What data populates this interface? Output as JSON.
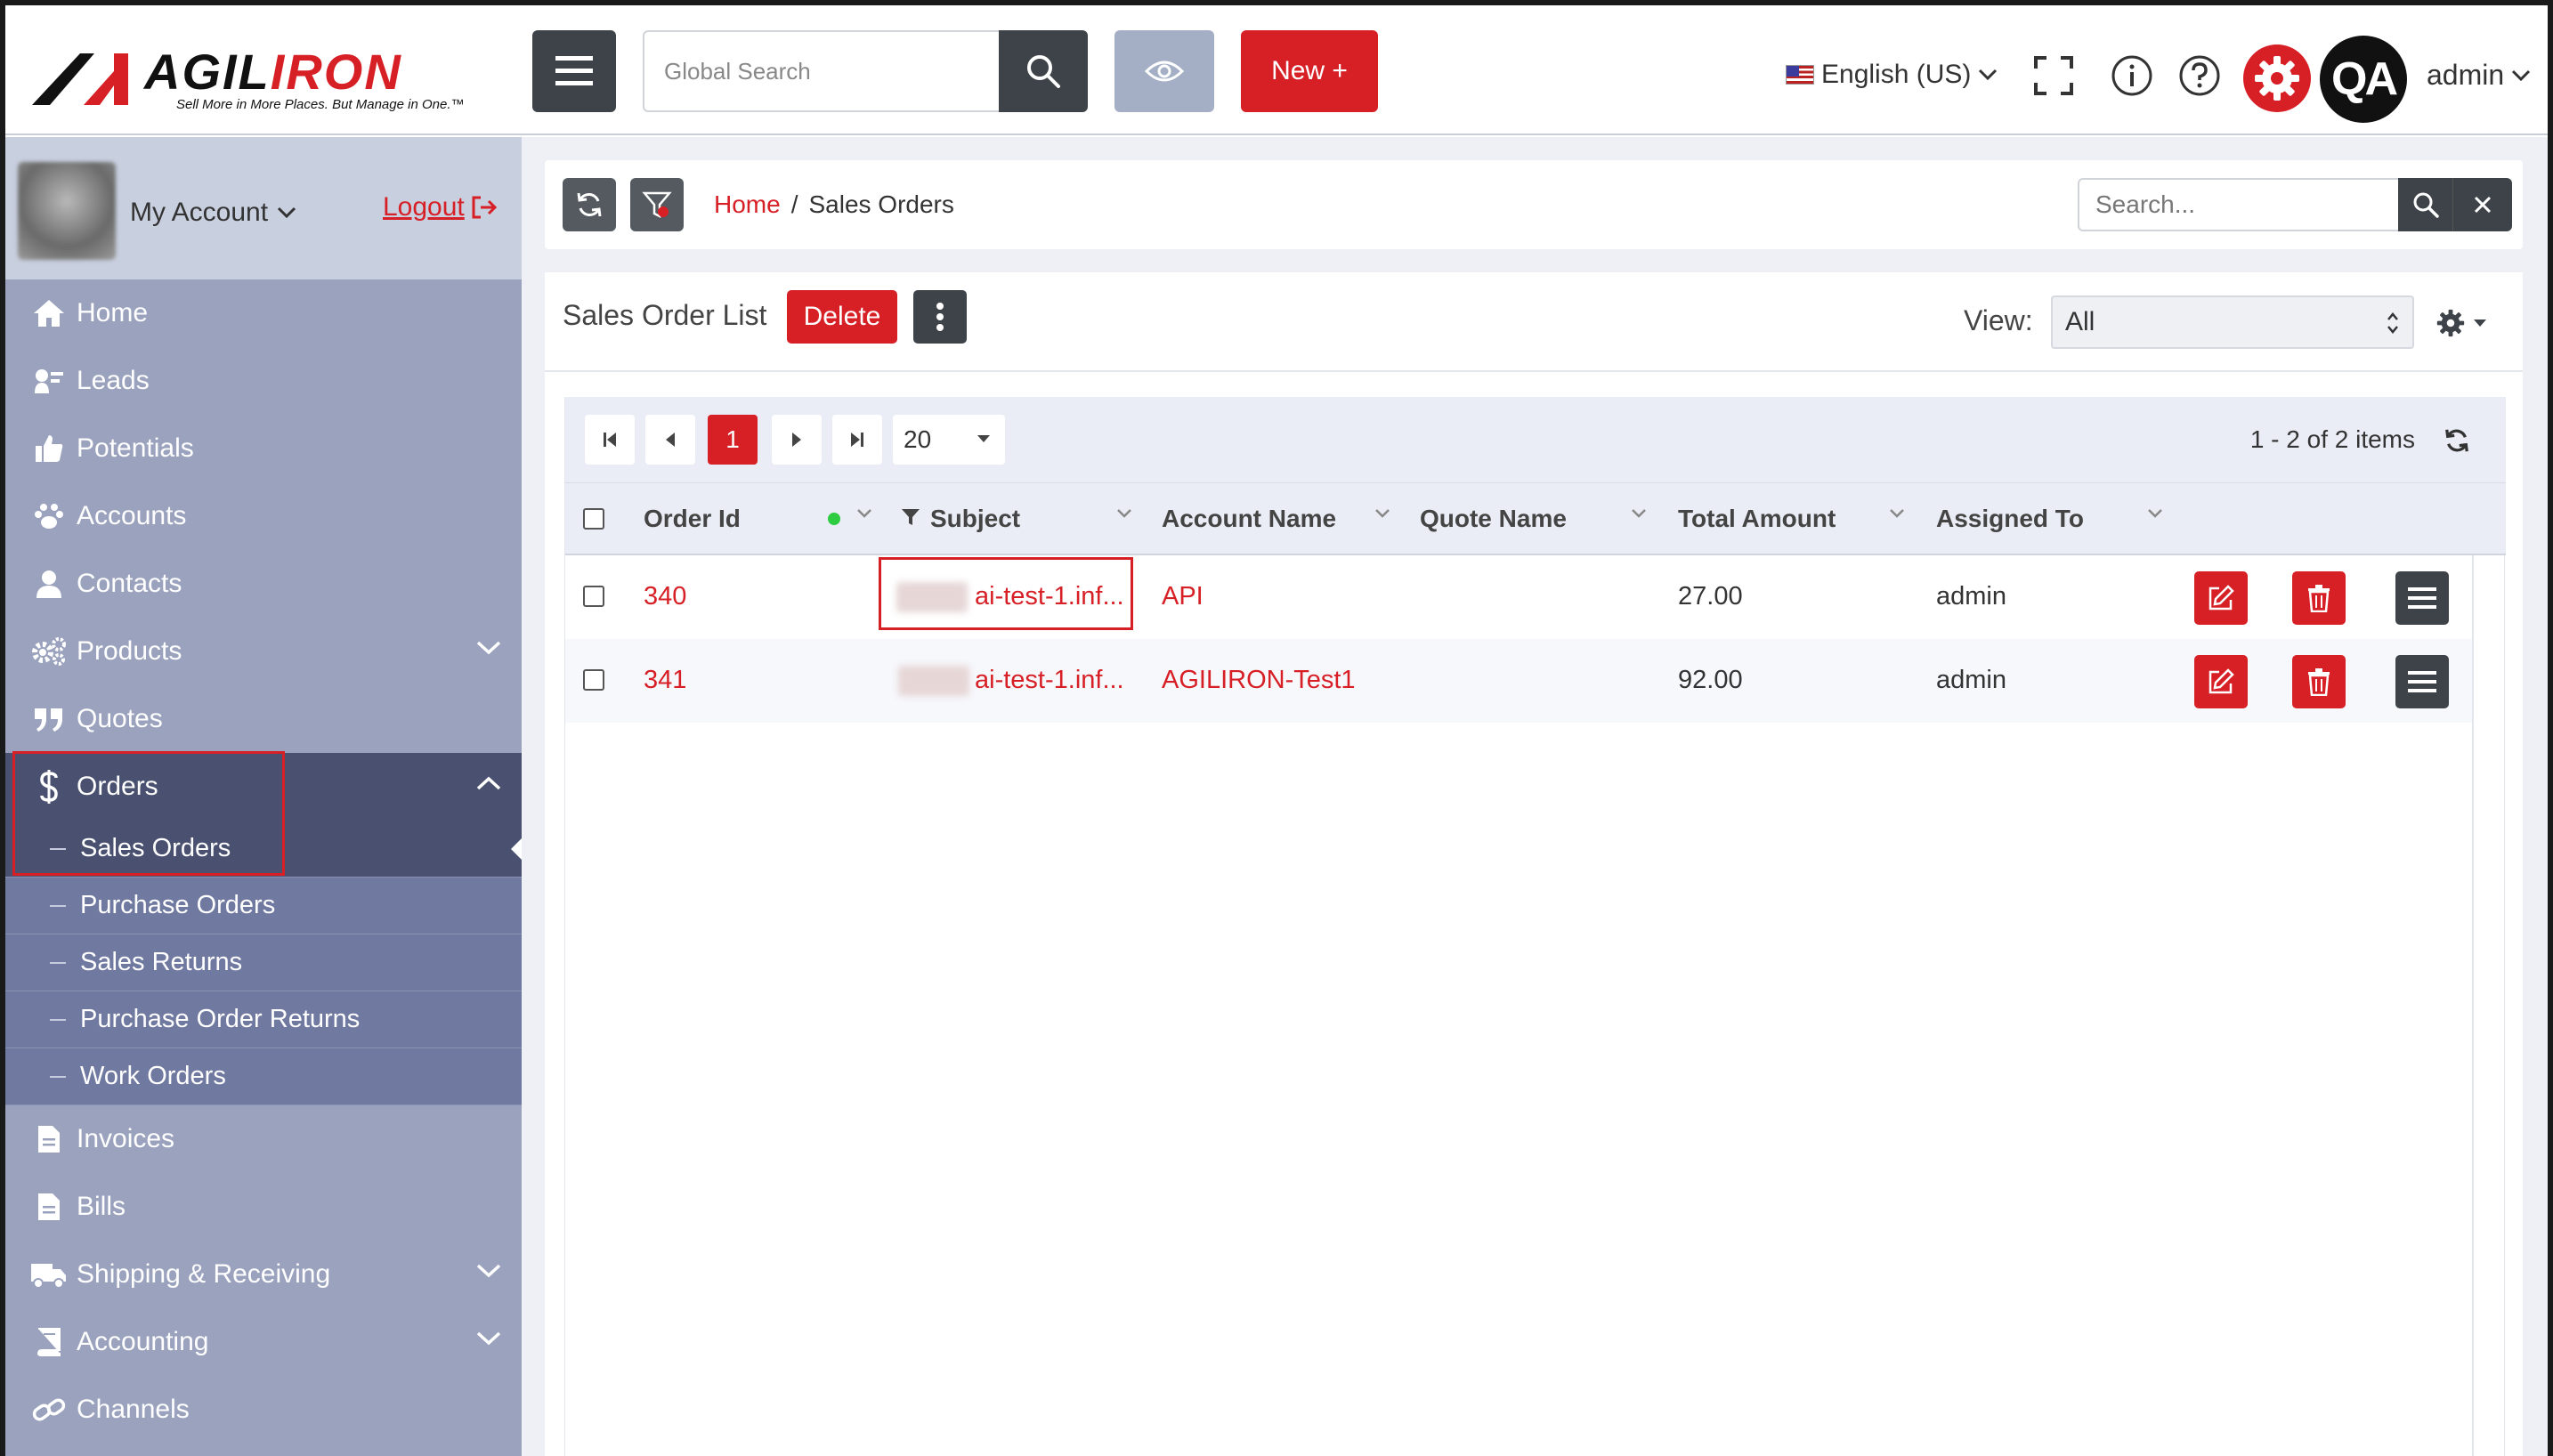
{
  "topbar": {
    "logo_text": "AGILIRON",
    "logo_tagline": "Sell More in More Places. But Manage in One.",
    "global_search_placeholder": "Global Search",
    "new_button_label": "New +",
    "language": "English (US)",
    "avatar_initials": "QA",
    "username": "admin"
  },
  "sidebar": {
    "account_label": "My Account",
    "logout_label": "Logout",
    "items": [
      {
        "label": "Home",
        "icon": "home-icon"
      },
      {
        "label": "Leads",
        "icon": "leads-icon"
      },
      {
        "label": "Potentials",
        "icon": "thumbs-up-icon"
      },
      {
        "label": "Accounts",
        "icon": "paw-icon"
      },
      {
        "label": "Contacts",
        "icon": "user-icon"
      },
      {
        "label": "Products",
        "icon": "cogs-icon"
      },
      {
        "label": "Quotes",
        "icon": "quote-icon"
      },
      {
        "label": "Orders",
        "icon": "dollar-icon"
      },
      {
        "label": "Invoices",
        "icon": "document-icon"
      },
      {
        "label": "Bills",
        "icon": "document-icon"
      },
      {
        "label": "Shipping & Receiving",
        "icon": "truck-icon"
      },
      {
        "label": "Accounting",
        "icon": "book-icon"
      },
      {
        "label": "Channels",
        "icon": "link-icon"
      }
    ],
    "orders_submenu": [
      "Sales Orders",
      "Purchase Orders",
      "Sales Returns",
      "Purchase Order Returns",
      "Work Orders"
    ]
  },
  "breadcrumb": {
    "home": "Home",
    "separator": "/",
    "current": "Sales Orders"
  },
  "content_search_placeholder": "Search...",
  "list": {
    "title": "Sales Order List",
    "delete_label": "Delete",
    "view_label": "View:",
    "view_value": "All",
    "current_page": "1",
    "page_size": "20",
    "items_info": "1 - 2 of 2 items",
    "columns": [
      "Order Id",
      "Subject",
      "Account Name",
      "Quote Name",
      "Total Amount",
      "Assigned To"
    ],
    "rows": [
      {
        "order_id": "340",
        "subject": "ai-test-1.inf...",
        "account": "API",
        "quote": "",
        "total": "27.00",
        "assigned": "admin"
      },
      {
        "order_id": "341",
        "subject": "ai-test-1.inf...",
        "account": "AGILIRON-Test1",
        "quote": "",
        "total": "92.00",
        "assigned": "admin"
      }
    ]
  },
  "colors": {
    "brand_red": "#d71f26",
    "sidebar_bg": "#9aa2be",
    "sidebar_active": "#4a5170",
    "dark_button": "#3d4348"
  }
}
